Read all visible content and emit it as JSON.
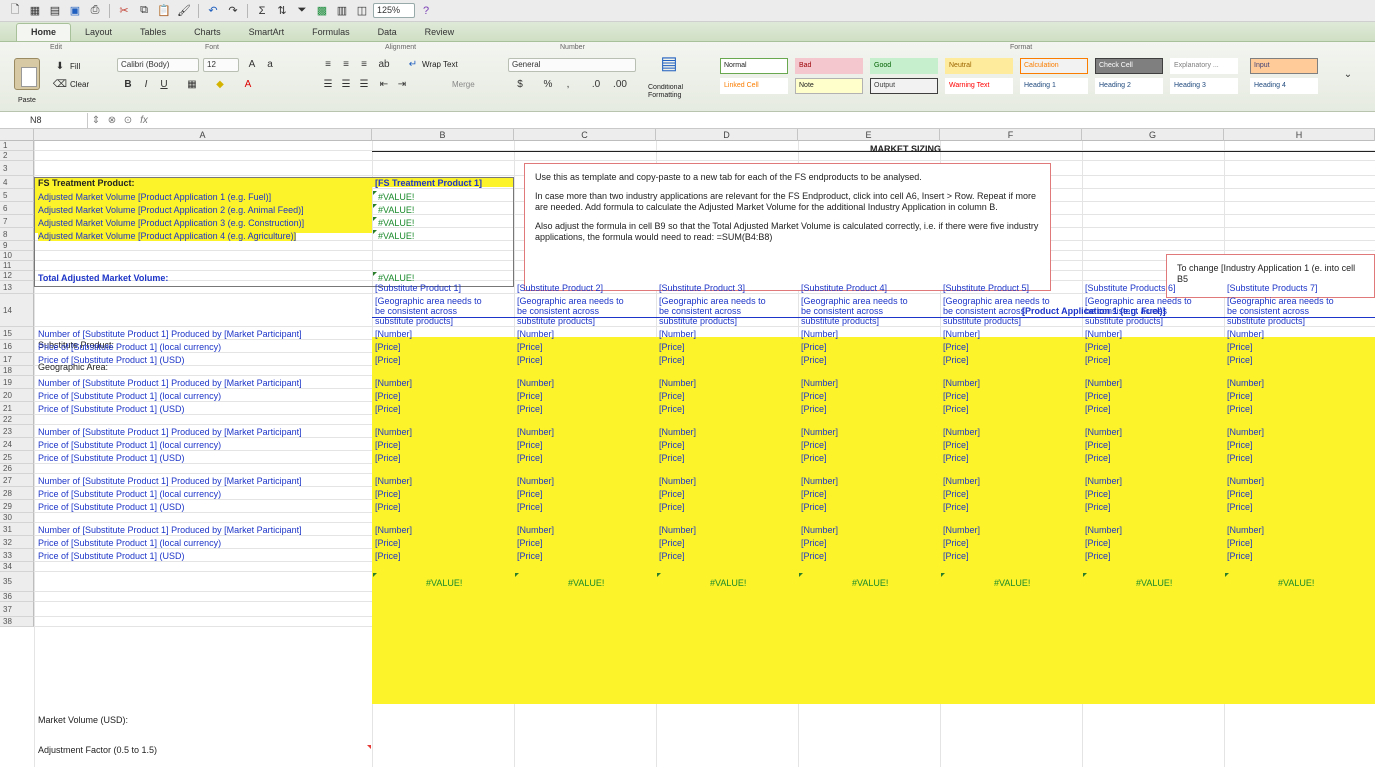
{
  "toolbar": {
    "zoom": "125%"
  },
  "ribbon_tabs": [
    "Home",
    "Layout",
    "Tables",
    "Charts",
    "SmartArt",
    "Formulas",
    "Data",
    "Review"
  ],
  "ribbon": {
    "group_edit": "Edit",
    "group_font": "Font",
    "group_alignment": "Alignment",
    "group_number": "Number",
    "group_format": "Format",
    "paste_label": "Paste",
    "clear_label": "Clear",
    "fill_label": "Fill",
    "font_name": "Calibri (Body)",
    "font_size": "12",
    "wrap_text": "Wrap Text",
    "merge": "Merge",
    "number_format": "General",
    "conditional_formatting": "Conditional Formatting",
    "styles": [
      {
        "label": "Normal",
        "bg": "#ffffff",
        "fg": "#222222",
        "border": "#6aa84f"
      },
      {
        "label": "Bad",
        "bg": "#f4c7ce",
        "fg": "#9c0006",
        "border": "#f4c7ce"
      },
      {
        "label": "Good",
        "bg": "#c6efce",
        "fg": "#006100",
        "border": "#c6efce"
      },
      {
        "label": "Neutral",
        "bg": "#ffeb9c",
        "fg": "#9c6500",
        "border": "#ffeb9c"
      },
      {
        "label": "Calculation",
        "bg": "#f2f2f2",
        "fg": "#fa7d00",
        "border": "#fa7d00"
      },
      {
        "label": "Check Cell",
        "bg": "#7f7f7f",
        "fg": "#ffffff",
        "border": "#3f3f3f"
      },
      {
        "label": "Explanatory ...",
        "bg": "#ffffff",
        "fg": "#7f7f7f",
        "border": "#ffffff"
      },
      {
        "label": "Input",
        "bg": "#ffcc99",
        "fg": "#3f3f76",
        "border": "#7f7f7f"
      },
      {
        "label": "Linked Cell",
        "bg": "#ffffff",
        "fg": "#fa7d00",
        "border": "#ffffff"
      },
      {
        "label": "Note",
        "bg": "#ffffcc",
        "fg": "#222222",
        "border": "#b2b2b2"
      },
      {
        "label": "Output",
        "bg": "#f2f2f2",
        "fg": "#3f3f3f",
        "border": "#3f3f3f"
      },
      {
        "label": "Warning Text",
        "bg": "#ffffff",
        "fg": "#ff0000",
        "border": "#ffffff"
      },
      {
        "label": "Heading 1",
        "bg": "#ffffff",
        "fg": "#1f497d",
        "border": "#ffffff"
      },
      {
        "label": "Heading 2",
        "bg": "#ffffff",
        "fg": "#1f497d",
        "border": "#ffffff"
      },
      {
        "label": "Heading 3",
        "bg": "#ffffff",
        "fg": "#1f497d",
        "border": "#ffffff"
      },
      {
        "label": "Heading 4",
        "bg": "#ffffff",
        "fg": "#1f497d",
        "border": "#ffffff"
      }
    ]
  },
  "formula_bar": {
    "name_box": "N8",
    "formula": ""
  },
  "columns": [
    "A",
    "B",
    "C",
    "D",
    "E",
    "F",
    "G",
    "H"
  ],
  "rows": [
    "1",
    "2",
    "3",
    "4",
    "5",
    "6",
    "7",
    "8",
    "9",
    "10",
    "11",
    "12",
    "13",
    "14",
    "15",
    "16",
    "17",
    "18",
    "19",
    "20",
    "21",
    "22",
    "23",
    "24",
    "25",
    "26",
    "27",
    "28",
    "29",
    "30",
    "31",
    "32",
    "33",
    "34",
    "35",
    "36",
    "37",
    "38"
  ],
  "sheet": {
    "market_sizing_title": "MARKET SIZING",
    "fs_treatment_label": "FS Treatment Product:",
    "fs_treatment_value": "[FS Treatment Product 1]",
    "applications": [
      "Adjusted Market Volume [Product Application 1 (e.g. Fuel)]",
      "Adjusted Market Volume [Product Application 2 (e.g. Animal Feed)]",
      "Adjusted Market Volume [Product Application 3 (e.g. Construction)]",
      "Adjusted Market Volume [Product Application 4 (e.g. Agriculture)]"
    ],
    "value_error": "#VALUE!",
    "total_label": "Total Adjusted Market Volume:",
    "note_paragraphs": [
      "Use this as template and copy-paste to a new tab for each of the FS endproducts to be analysed.",
      "In case more than two industry applications are relevant for the FS Endproduct, click into cell A6, Insert > Row. Repeat if more are needed. Add formula to calculate the Adjusted Market Volume for the additional Industry Application in column B.",
      "Also adjust the formula in cell B9 so that the Total Adjusted Market Volume is calculated correctly, i.e. if there were five industry applications, the formula would need to read: =SUM(B4:B8)"
    ],
    "note2": "To change [Industry Application 1 (e. into cell B5",
    "product_app_header": "[Product Application 1 (e.g. Fuel)]",
    "substitute_label": "Substitute Product:",
    "geographic_label": "Geographic Area:",
    "substitute_products": [
      "[Substitute Product 1]",
      "[Substitute Product 2]",
      "[Substitute Product 3]",
      "[Substitute Product 4]",
      "[Substitute Product 5]",
      "[Substitute Products 6]",
      "[Substitute Products 7]"
    ],
    "geo_note_lines": [
      "[Geographic area needs to",
      "be consistent across",
      "substitute products]"
    ],
    "row_number_label": "Number of [Substitute Product 1] Produced by [Market Participant]",
    "row_price_local_label": "Price of [Substitute Product 1] (local currency)",
    "row_price_usd_label": "Price of [Substitute Product 1] (USD)",
    "number_placeholder": "[Number]",
    "price_placeholder": "[Price]",
    "market_volume_label": "Market Volume (USD):",
    "adjustment_label": "Adjustment Factor (0.5 to 1.5)"
  }
}
